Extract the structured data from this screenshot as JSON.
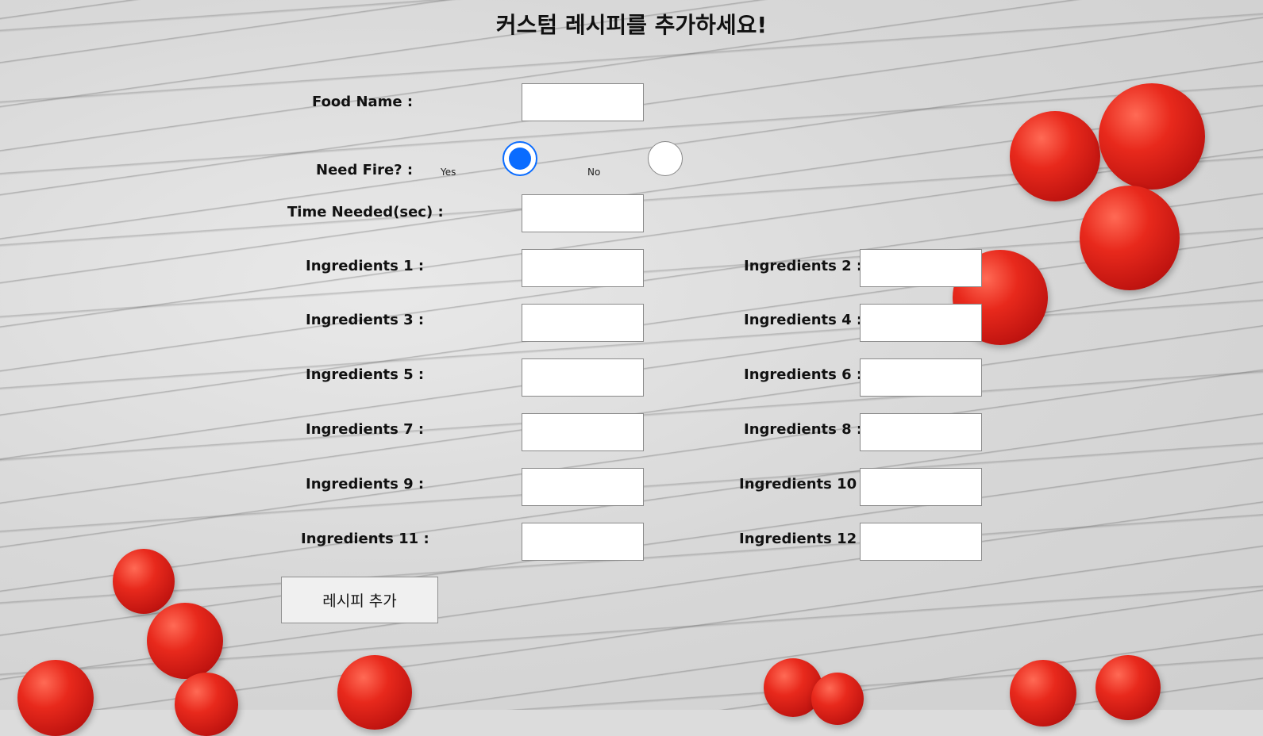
{
  "title": "커스텀 레시피를 추가하세요!",
  "form": {
    "food_name_label": "Food Name :",
    "food_name_value": "",
    "need_fire_label": "Need Fire? :",
    "need_fire_yes": "Yes",
    "need_fire_no": "No",
    "need_fire_selected": "Yes",
    "time_needed_label": "Time Needed(sec) :",
    "time_needed_value": "",
    "ingredients": [
      {
        "label": "Ingredients 1 :",
        "value": ""
      },
      {
        "label": "Ingredients 2 :",
        "value": ""
      },
      {
        "label": "Ingredients 3 :",
        "value": ""
      },
      {
        "label": "Ingredients 4 :",
        "value": ""
      },
      {
        "label": "Ingredients 5 :",
        "value": ""
      },
      {
        "label": "Ingredients 6 :",
        "value": ""
      },
      {
        "label": "Ingredients 7 :",
        "value": ""
      },
      {
        "label": "Ingredients 8 :",
        "value": ""
      },
      {
        "label": "Ingredients 9 :",
        "value": ""
      },
      {
        "label": "Ingredients 10 :",
        "value": ""
      },
      {
        "label": "Ingredients 11 :",
        "value": ""
      },
      {
        "label": "Ingredients 12 :",
        "value": ""
      }
    ],
    "submit_label": "레시피 추가"
  },
  "colors": {
    "accent": "#0a6cff",
    "tomato": "#e8291c"
  }
}
